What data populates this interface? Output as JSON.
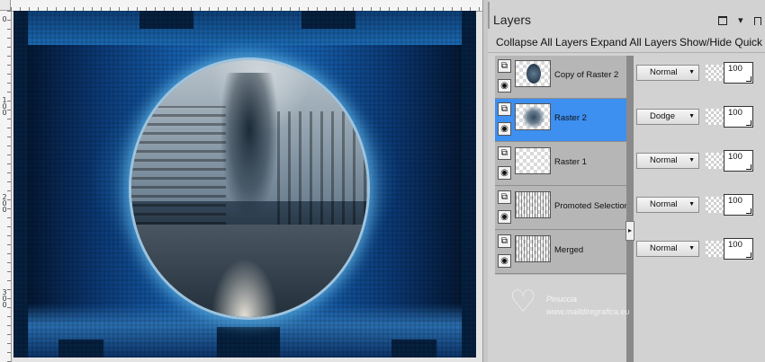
{
  "canvas": {
    "ruler_top_numbers": [],
    "ruler_left_labels": [
      "0",
      "1\n0\n0",
      "2\n0\n0",
      "3\n0\n0"
    ]
  },
  "layers_panel": {
    "title": "Layers",
    "window_controls": {
      "restore_icon": "restore-icon",
      "menu_arrow": "▾",
      "pin_icon": "pin-icon",
      "close": "✕"
    },
    "toolbar": {
      "collapse_all": "Collapse All Layers",
      "expand_all": "Expand All Layers",
      "show_hide": "Show/Hide Quick S"
    },
    "selected_color": "#3d8ff0",
    "layers": [
      {
        "name": "Copy of Raster 2",
        "thumb": "circle-photo",
        "blend": "Normal",
        "opacity": "100",
        "selected": false
      },
      {
        "name": "Raster 2",
        "thumb": "blur-mask",
        "blend": "Dodge",
        "opacity": "100",
        "selected": true
      },
      {
        "name": "Raster 1",
        "thumb": "transparent",
        "blend": "Normal",
        "opacity": "100",
        "selected": false
      },
      {
        "name": "Promoted Selection",
        "thumb": "blue-pattern",
        "blend": "Normal",
        "opacity": "100",
        "selected": false
      },
      {
        "name": "Merged",
        "thumb": "blue-pattern",
        "blend": "Normal",
        "opacity": "100",
        "selected": false
      }
    ],
    "icons": {
      "link": "link-icon",
      "visibility": "eye-icon"
    },
    "scroll_arrow": "▸"
  },
  "watermark": {
    "name": "Pinuccia",
    "url": "www.maildiregrafica.eu"
  }
}
